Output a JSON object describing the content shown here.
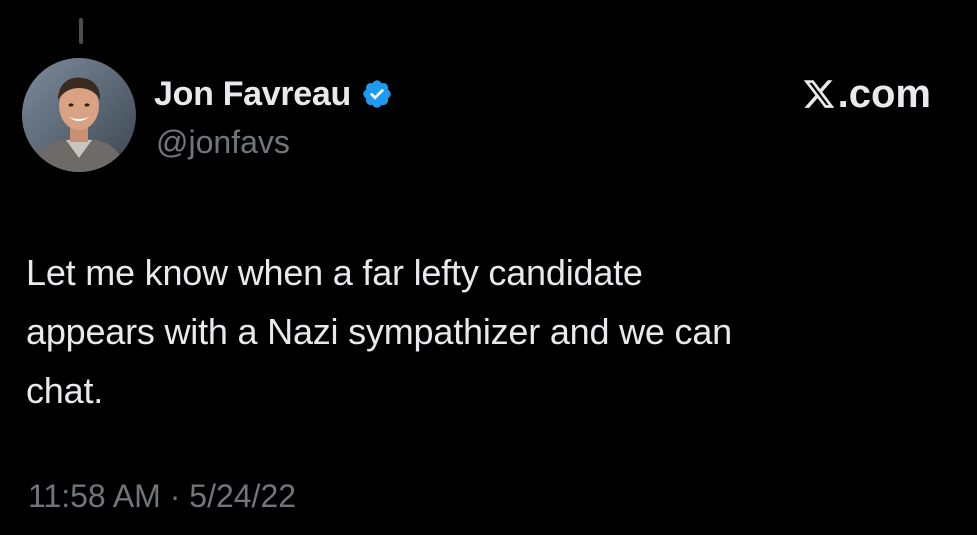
{
  "author": {
    "name": "Jon Favreau",
    "handle": "@jonfavs",
    "verified_icon": "verified-badge-icon",
    "verified_color": "#1d9bf0"
  },
  "brand": {
    "logo_icon": "x-logo-icon",
    "text": ".com"
  },
  "tweet": {
    "lines": [
      "Let me know when a far lefty candidate",
      "appears with a Nazi sympathizer and we can",
      "chat."
    ],
    "timestamp": "11:58 AM · 5/24/22"
  },
  "colors": {
    "background": "#000000",
    "primary_text": "#e7e9ea",
    "secondary_text": "#71767b"
  }
}
